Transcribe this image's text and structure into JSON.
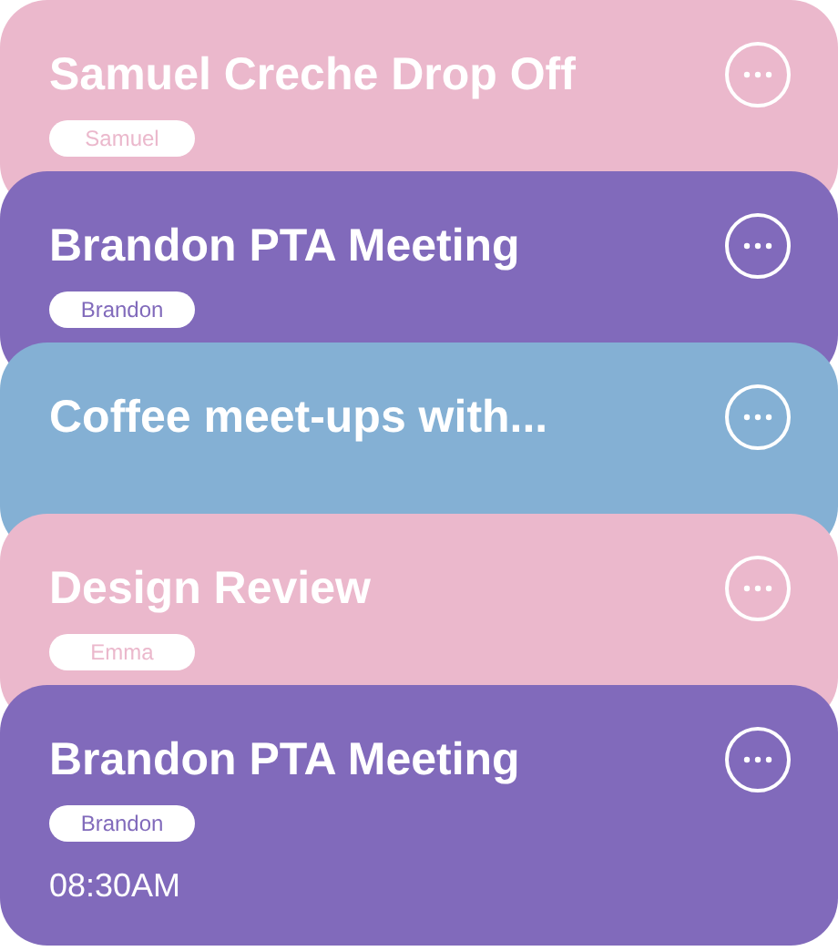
{
  "cards": [
    {
      "title": "Samuel Creche Drop Off",
      "tag": "Samuel",
      "color": "#ebb8cc"
    },
    {
      "title": "Brandon PTA Meeting",
      "tag": "Brandon",
      "color": "#816abb"
    },
    {
      "title": "Coffee meet-ups with...",
      "color": "#84b0d4"
    },
    {
      "title": "Design Review",
      "tag": "Emma",
      "color": "#ebb8cc"
    },
    {
      "title": "Brandon PTA Meeting",
      "tag": "Brandon",
      "color": "#816abb",
      "time": "08:30AM"
    }
  ]
}
